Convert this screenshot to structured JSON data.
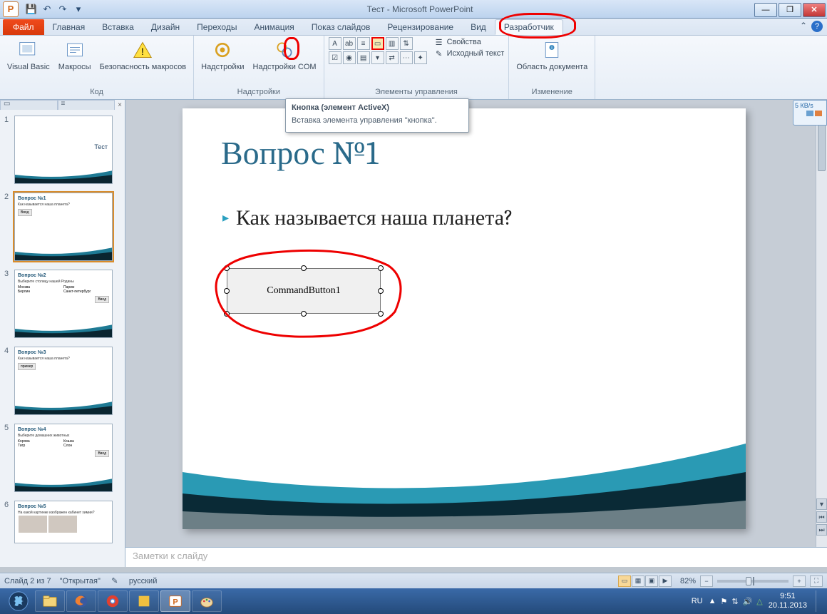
{
  "window": {
    "title": "Тест - Microsoft PowerPoint"
  },
  "ribbon_tabs": {
    "file": "Файл",
    "items": [
      "Главная",
      "Вставка",
      "Дизайн",
      "Переходы",
      "Анимация",
      "Показ слайдов",
      "Рецензирование",
      "Вид",
      "Разработчик"
    ],
    "active": "Разработчик"
  },
  "groups": {
    "code": {
      "label": "Код",
      "vb": "Visual Basic",
      "macros": "Макросы",
      "security": "Безопасность макросов"
    },
    "addins": {
      "label": "Надстройки",
      "addins": "Надстройки",
      "com": "Надстройки COM"
    },
    "controls": {
      "label": "Элементы управления",
      "props": "Свойства",
      "source": "Исходный текст"
    },
    "modify": {
      "label": "Изменение",
      "docpanel": "Область документа"
    }
  },
  "tooltip": {
    "title": "Кнопка (элемент ActiveX)",
    "body": "Вставка элемента управления \"кнопка\"."
  },
  "slide": {
    "title": "Вопрос №1",
    "question": "Как называется наша планета?",
    "cmdbutton": "CommandButton1"
  },
  "thumbnails": [
    {
      "n": "1",
      "title": "Тест"
    },
    {
      "n": "2",
      "title": "Вопрос №1",
      "body": "Как называется наша планета?"
    },
    {
      "n": "3",
      "title": "Вопрос №2",
      "body": "Выберите столицу нашей Родины",
      "opts": [
        "Москва",
        "Париж",
        "Берлин",
        "Санкт-петербург"
      ]
    },
    {
      "n": "4",
      "title": "Вопрос №3",
      "body": "Как называется наша планета?"
    },
    {
      "n": "5",
      "title": "Вопрос №4",
      "body": "Выберите домашних животных",
      "opts": [
        "Корова",
        "Кошка",
        "Тигр",
        "Слон"
      ]
    },
    {
      "n": "6",
      "title": "Вопрос №5",
      "body": "На какой картинке изображен кабинет химии?"
    }
  ],
  "notes_placeholder": "Заметки к слайду",
  "status": {
    "slide": "Слайд 2 из 7",
    "theme": "\"Открытая\"",
    "lang": "русский",
    "zoom": "82%"
  },
  "tray": {
    "lang": "RU",
    "time": "9:51",
    "date": "20.11.2013",
    "speed": "5 КВ/s"
  }
}
